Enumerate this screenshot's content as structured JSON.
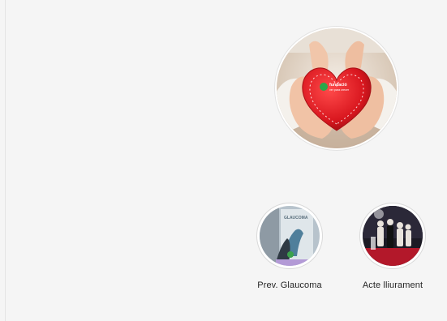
{
  "profile": {
    "avatar_logo_text": "fundació",
    "avatar_logo_subtext": "ver para crecer"
  },
  "highlights": [
    {
      "label": "Prev. Glaucoma",
      "thumb_text": "GLAUCOMA"
    },
    {
      "label": "Acte lliurament"
    }
  ],
  "colors": {
    "background": "#f5f5f5",
    "heart": "#d9171f",
    "logo_green": "#2aa84a"
  }
}
